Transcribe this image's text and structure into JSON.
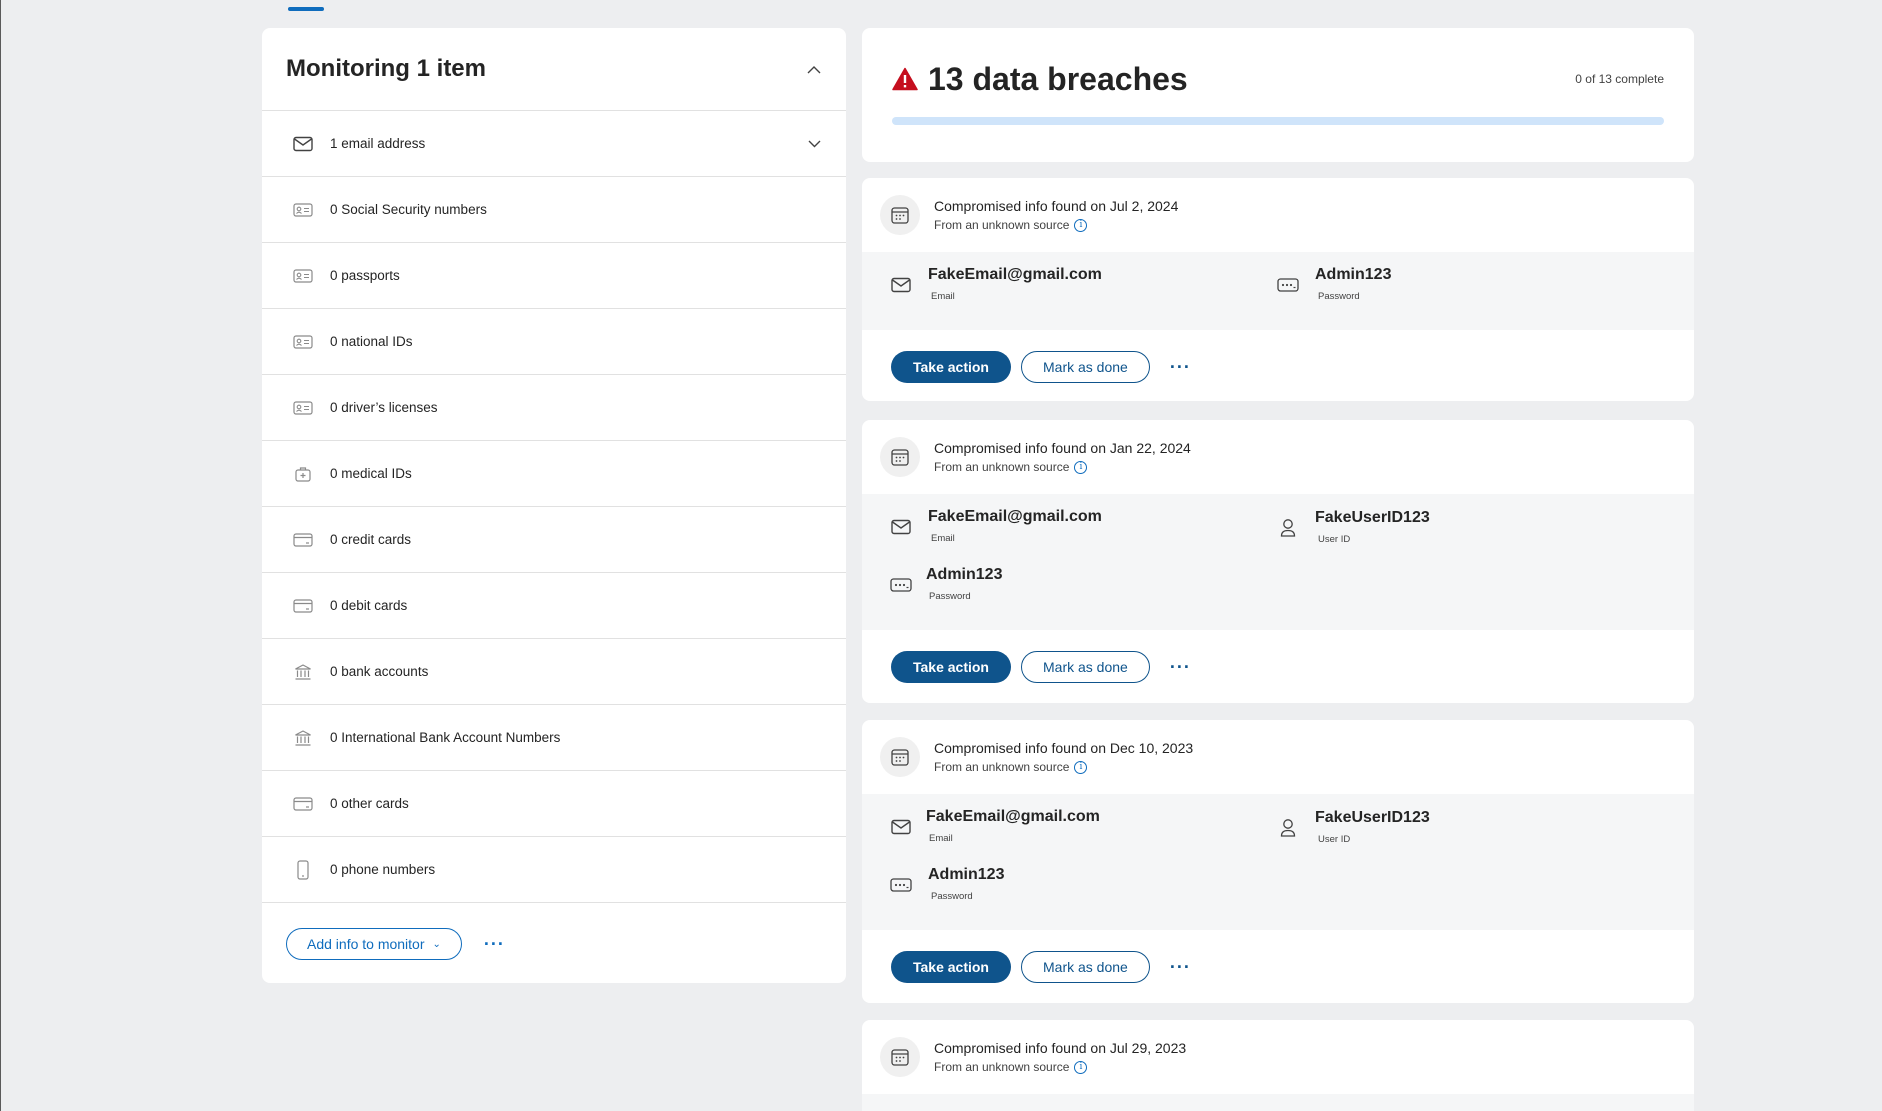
{
  "monitoring": {
    "title": "Monitoring 1 item",
    "items": [
      {
        "label": "1 email address",
        "icon": "mail-icon"
      },
      {
        "label": "0 Social Security numbers",
        "icon": "id-card-icon"
      },
      {
        "label": "0 passports",
        "icon": "id-card-icon"
      },
      {
        "label": "0 national IDs",
        "icon": "id-card-icon"
      },
      {
        "label": "0 driver’s licenses",
        "icon": "id-card-icon"
      },
      {
        "label": "0 medical IDs",
        "icon": "medical-bag-icon"
      },
      {
        "label": "0 credit cards",
        "icon": "card-icon"
      },
      {
        "label": "0 debit cards",
        "icon": "card-icon"
      },
      {
        "label": "0 bank accounts",
        "icon": "bank-icon"
      },
      {
        "label": "0 International Bank Account Numbers",
        "icon": "bank-icon"
      },
      {
        "label": "0 other cards",
        "icon": "card-icon"
      },
      {
        "label": "0 phone numbers",
        "icon": "phone-icon"
      }
    ],
    "add_button": "Add info to monitor",
    "more": "···"
  },
  "summary": {
    "title": "13 data breaches",
    "complete": "0 of 13 complete",
    "progress": 0
  },
  "breaches": [
    {
      "found": "Compromised info found on Jul 2, 2024",
      "source": "From an unknown source",
      "fields": [
        {
          "value": "FakeEmail@gmail.com",
          "label": "Email",
          "icon": "mail-icon"
        },
        {
          "value": "Admin123",
          "label": "Password",
          "icon": "password-icon"
        }
      ]
    },
    {
      "found": "Compromised info found on Jan 22, 2024",
      "source": "From an unknown source",
      "fields": [
        {
          "value": "FakeEmail@gmail.com",
          "label": "Email",
          "icon": "mail-icon"
        },
        {
          "value": "FakeUserID123",
          "label": "User ID",
          "icon": "person-icon"
        },
        {
          "value": "Admin123",
          "label": "Password",
          "icon": "password-icon"
        }
      ]
    },
    {
      "found": "Compromised info found on Dec 10, 2023",
      "source": "From an unknown source",
      "fields": [
        {
          "value": "FakeEmail@gmail.com",
          "label": "Email",
          "icon": "mail-icon"
        },
        {
          "value": "FakeUserID123",
          "label": "User ID",
          "icon": "person-icon"
        },
        {
          "value": "Admin123",
          "label": "Password",
          "icon": "password-icon"
        }
      ]
    },
    {
      "found": "Compromised info found on Jul 29, 2023",
      "source": "From an unknown source",
      "fields": []
    }
  ],
  "actions": {
    "take_action": "Take action",
    "mark_done": "Mark as done",
    "more": "···"
  },
  "colors": {
    "accent": "#0f6cbd",
    "primary_button": "#0f548c",
    "warning": "#c50f1f",
    "progress_track": "#cfe4fa"
  }
}
